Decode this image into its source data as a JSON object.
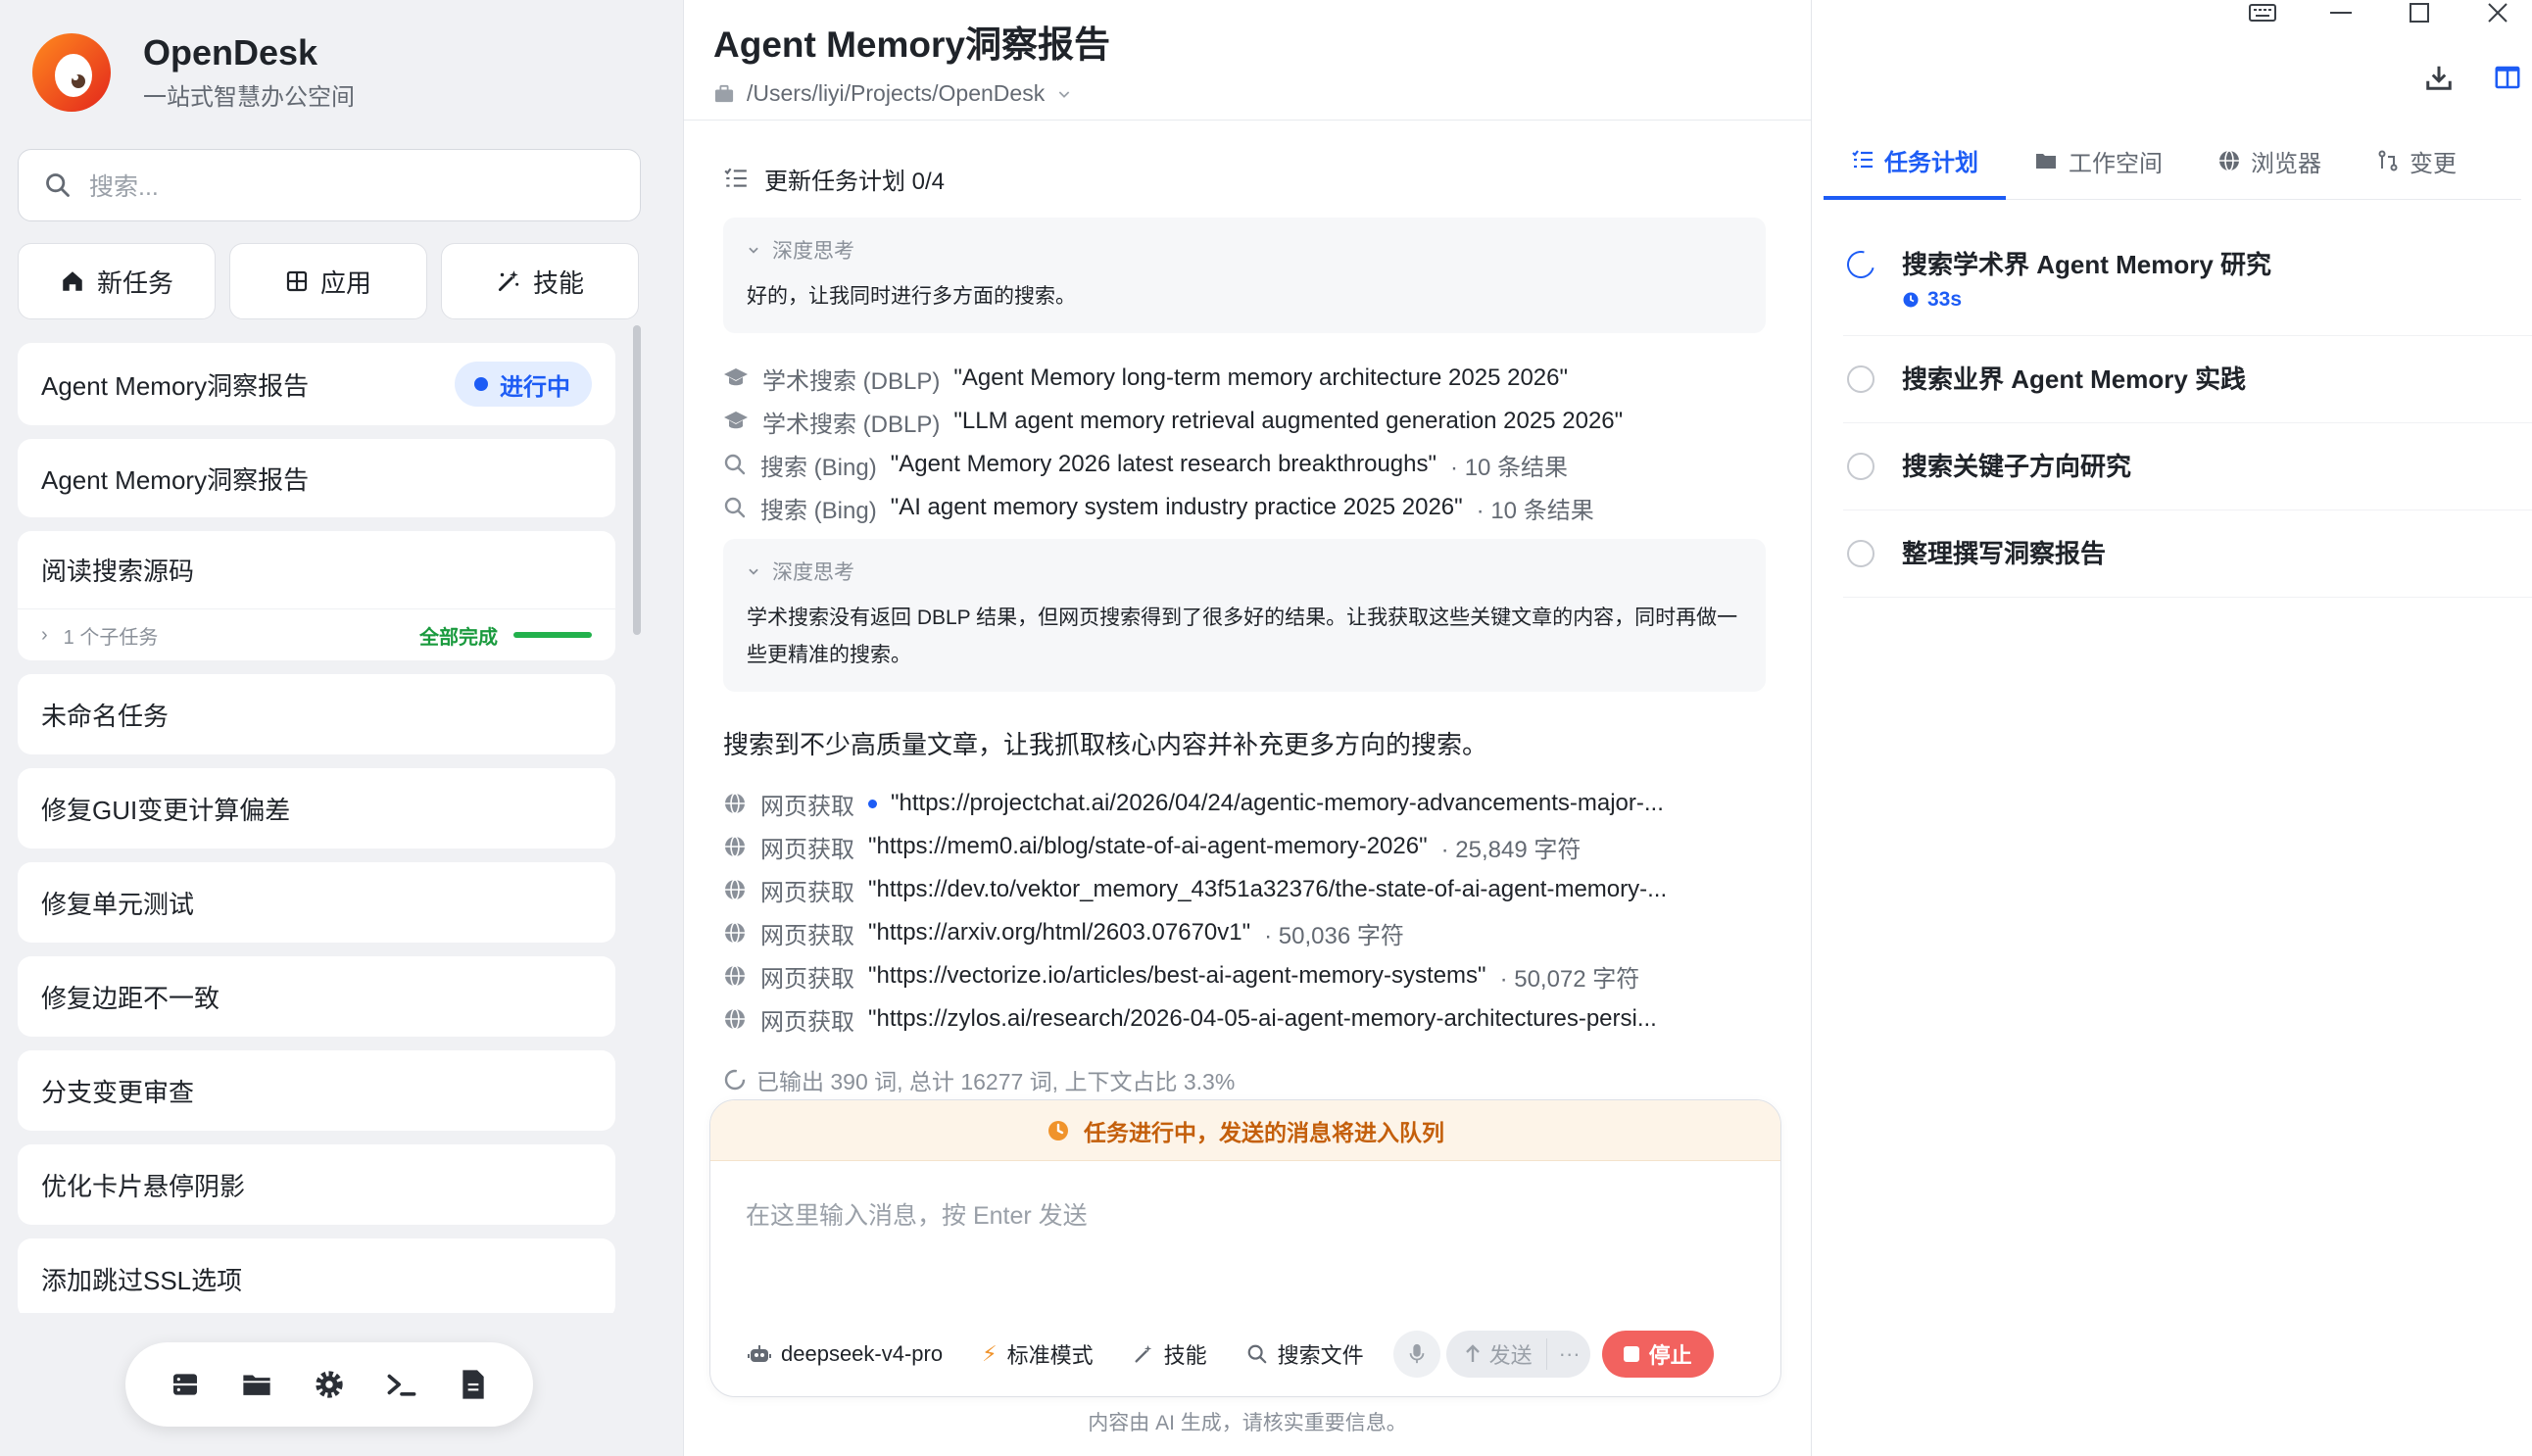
{
  "app": {
    "name": "OpenDesk",
    "tagline": "一站式智慧办公空间"
  },
  "search": {
    "placeholder": "搜索..."
  },
  "quick_actions": [
    {
      "label": "新任务",
      "icon": "home-icon"
    },
    {
      "label": "应用",
      "icon": "grid-icon"
    },
    {
      "label": "技能",
      "icon": "magic-wand-icon"
    }
  ],
  "tasks": {
    "active": {
      "label": "Agent Memory洞察报告",
      "status": "进行中"
    },
    "items": [
      "Agent Memory洞察报告",
      "阅读搜索源码",
      "未命名任务",
      "修复GUI变更计算偏差",
      "修复单元测试",
      "修复边距不一致",
      "分支变更审查",
      "优化卡片悬停阴影",
      "添加跳过SSL选项"
    ],
    "group": {
      "subtasks": "1 个子任务",
      "done": "全部完成",
      "progress": 1.0
    }
  },
  "dock": [
    "storage-icon",
    "folder-icon",
    "settings-icon",
    "terminal-icon",
    "document-icon"
  ],
  "main": {
    "title": "Agent Memory洞察报告",
    "path": "/Users/liyi/Projects/OpenDesk",
    "plan_update": "更新任务计划  0/4",
    "think1": {
      "label": "深度思考",
      "text": "好的，让我同时进行多方面的搜索。"
    },
    "searches": [
      {
        "icon": "academic-icon",
        "name": "学术搜索 (DBLP)",
        "query": "\"Agent Memory long-term memory architecture 2025 2026\"",
        "meta": ""
      },
      {
        "icon": "academic-icon",
        "name": "学术搜索 (DBLP)",
        "query": "\"LLM agent memory retrieval augmented generation 2025 2026\"",
        "meta": ""
      },
      {
        "icon": "search-icon",
        "name": "搜索 (Bing)",
        "query": "\"Agent Memory 2026 latest research breakthroughs\"",
        "meta": "· 10 条结果"
      },
      {
        "icon": "search-icon",
        "name": "搜索 (Bing)",
        "query": "\"AI agent memory system industry practice 2025 2026\"",
        "meta": "· 10 条结果"
      }
    ],
    "think2": {
      "label": "深度思考",
      "text": "学术搜索没有返回 DBLP 结果，但网页搜索得到了很多好的结果。让我获取这些关键文章的内容，同时再做一些更精准的搜索。"
    },
    "message": "搜索到不少高质量文章，让我抓取核心内容并补充更多方向的搜索。",
    "fetches": [
      {
        "name": "网页获取",
        "url": "\"https://projectchat.ai/2026/04/24/agentic-memory-advancements-major-...",
        "meta": "",
        "loading": true
      },
      {
        "name": "网页获取",
        "url": "\"https://mem0.ai/blog/state-of-ai-agent-memory-2026\"",
        "meta": "· 25,849 字符",
        "loading": false
      },
      {
        "name": "网页获取",
        "url": "\"https://dev.to/vektor_memory_43f51a32376/the-state-of-ai-agent-memory-...",
        "meta": "",
        "loading": false
      },
      {
        "name": "网页获取",
        "url": "\"https://arxiv.org/html/2603.07670v1\"",
        "meta": "· 50,036 字符",
        "loading": false
      },
      {
        "name": "网页获取",
        "url": "\"https://vectorize.io/articles/best-ai-agent-memory-systems\"",
        "meta": "· 50,072 字符",
        "loading": false
      },
      {
        "name": "网页获取",
        "url": "\"https://zylos.ai/research/2026-04-05-ai-agent-memory-architectures-persi...",
        "meta": "",
        "loading": false
      }
    ],
    "status": "已输出 390 词, 总计 16277 词, 上下文占比 3.3%"
  },
  "composer": {
    "queue_notice": "任务进行中，发送的消息将进入队列",
    "placeholder": "在这里输入消息，按 Enter 发送",
    "model": "deepseek-v4-pro",
    "mode": "标准模式",
    "skills": "技能",
    "search_files": "搜索文件",
    "send": "发送",
    "more": "···",
    "stop": "停止"
  },
  "footnote": "内容由 AI 生成，请核实重要信息。",
  "right": {
    "tabs": [
      {
        "label": "任务计划",
        "icon": "checklist-icon",
        "active": true
      },
      {
        "label": "工作空间",
        "icon": "folder-icon",
        "active": false
      },
      {
        "label": "浏览器",
        "icon": "globe-icon",
        "active": false
      },
      {
        "label": "变更",
        "icon": "branch-icon",
        "active": false
      }
    ],
    "plan": [
      {
        "text": "搜索学术界 Agent Memory 研究",
        "time": "33s",
        "running": true
      },
      {
        "text": "搜索业界 Agent Memory 实践",
        "time": "",
        "running": false
      },
      {
        "text": "搜索关键子方向研究",
        "time": "",
        "running": false
      },
      {
        "text": "整理撰写洞察报告",
        "time": "",
        "running": false
      }
    ]
  },
  "colors": {
    "accent": "#1d5cf5",
    "success": "#1a9a3e",
    "warning": "#c45f0b",
    "danger": "#f2625f"
  }
}
